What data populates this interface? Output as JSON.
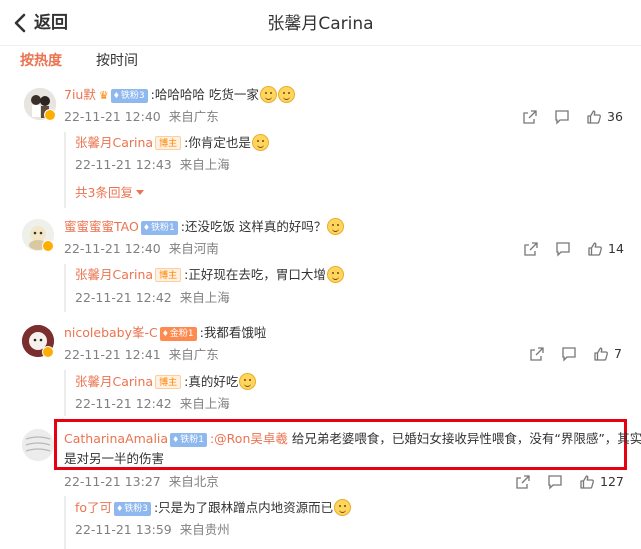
{
  "header": {
    "back_label": "返回",
    "title": "张馨月Carina"
  },
  "sort_tabs": [
    {
      "label": "按热度",
      "active": true
    },
    {
      "label": "按时间",
      "active": false
    }
  ],
  "colors": {
    "accent": "#eb7350",
    "highlight_box": "#e60012",
    "badge_blue": "#8fb8ee"
  },
  "comments": [
    {
      "user": "7iu默",
      "badge": "铁粉3",
      "text": ":哈哈哈哈 吃货一家",
      "emoji_count": 2,
      "time": "22-11-21 12:40",
      "location": "来自广东",
      "likes": "36",
      "replies": [
        {
          "user": "张馨月Carina",
          "badge": "博主",
          "text": ":你肯定也是",
          "time": "22-11-21 12:43",
          "location": "来自上海"
        }
      ],
      "more_replies": "共3条回复"
    },
    {
      "user": "蜜蜜蜜蜜TAO",
      "badge": "铁粉1",
      "text": ":还没吃饭 这样真的好吗？",
      "time": "22-11-21 12:40",
      "location": "来自河南",
      "likes": "14",
      "replies": [
        {
          "user": "张馨月Carina",
          "badge": "博主",
          "text": ":正好现在去吃，胃口大增",
          "time": "22-11-21 12:42",
          "location": "来自上海"
        }
      ]
    },
    {
      "user": "nicolebaby峯-C",
      "badge": "金粉1",
      "text": ":我都看饿啦",
      "time": "22-11-21 12:41",
      "location": "来自广东",
      "likes": "7",
      "replies": [
        {
          "user": "张馨月Carina",
          "badge": "博主",
          "text": ":真的好吃",
          "time": "22-11-21 12:42",
          "location": "来自上海"
        }
      ]
    },
    {
      "user": "CatharinaAmalia",
      "badge": "铁粉1",
      "mention": ":@Ron吴卓羲",
      "text_line1": " 给兄弟老婆喂食，已婚妇女接收异性喂食，没有“界限感”，其实就",
      "text_line2": "是对另一半的伤害",
      "time": "22-11-21 13:27",
      "location": "来自北京",
      "likes": "127",
      "replies": [
        {
          "user": "fo了可",
          "badge": "铁粉3",
          "text": ":只是为了跟林蹭点内地资源而已",
          "time": "22-11-21 13:59",
          "location": "来自贵州"
        }
      ]
    }
  ],
  "icons": {
    "share": "share-icon",
    "comment": "comment-icon",
    "like": "thumbs-up-icon"
  }
}
